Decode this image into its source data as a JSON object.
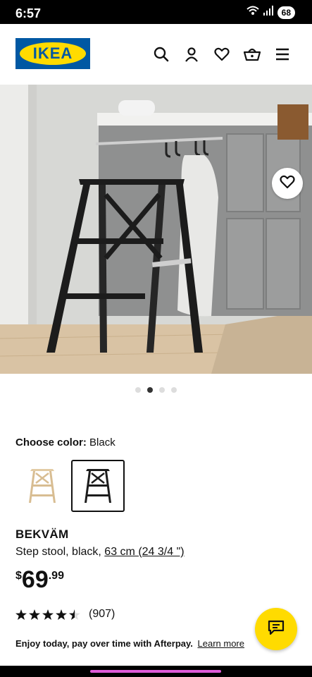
{
  "status_bar": {
    "time": "6:57",
    "battery": "68"
  },
  "header": {
    "logo_text": "IKEA",
    "icons": [
      "search-icon",
      "account-icon",
      "heart-icon",
      "basket-icon",
      "menu-icon"
    ]
  },
  "gallery": {
    "image_count": 4,
    "active_index": 1
  },
  "color_picker": {
    "label": "Choose color:",
    "selected": "Black",
    "options": [
      {
        "name": "birch",
        "color": "#e2cba4"
      },
      {
        "name": "black",
        "color": "#1c1c1c"
      }
    ]
  },
  "product": {
    "name": "BEKVÄM",
    "description": "Step stool, black,",
    "size": "63 cm (24 3/4 \")",
    "currency": "$",
    "price_int": "69",
    "price_dec": ".99",
    "rating_value": 4.5,
    "rating_count": "(907)"
  },
  "afterpay": {
    "text": "Enjoy today, pay over time with Afterpay.",
    "link": "Learn more"
  },
  "colors": {
    "ikea_blue": "#0058a3",
    "ikea_yellow": "#ffdb00"
  }
}
